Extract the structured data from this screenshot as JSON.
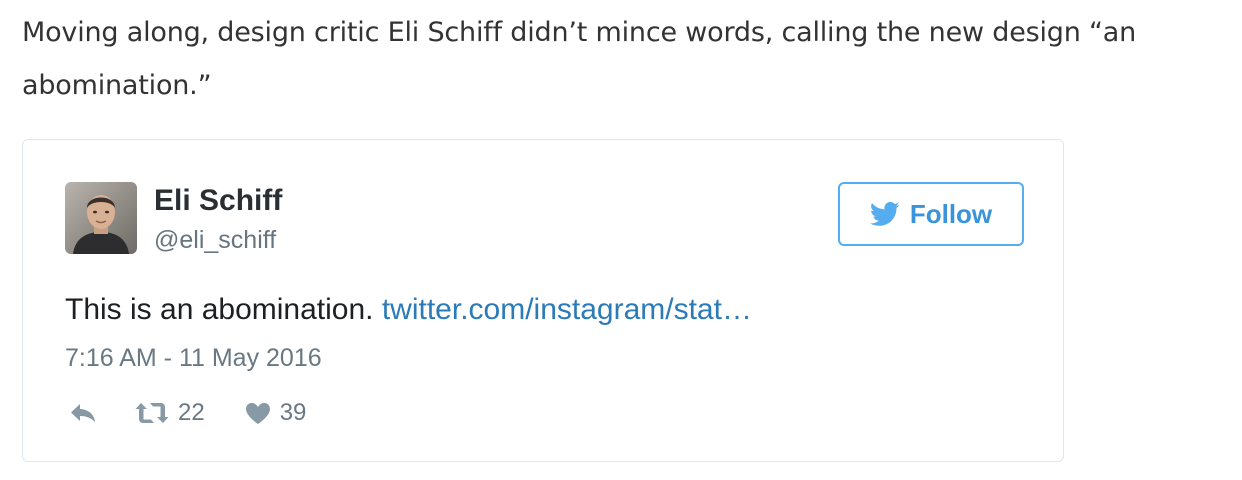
{
  "article": {
    "paragraph": "Moving along, design critic Eli Schiff didn’t mince words, calling the new design “an abomination.”"
  },
  "tweet": {
    "author_name": "Eli Schiff",
    "author_handle": "@eli_schiff",
    "follow_label": "Follow",
    "follow_icon": "twitter-bird-icon",
    "avatar_icon": "profile-photo",
    "text": "This is an abomination.",
    "link_text": "twitter.com/instagram/stat…",
    "timestamp": "7:16 AM - 11 May 2016",
    "retweet_count": "22",
    "like_count": "39",
    "action_icons": [
      "reply-icon",
      "retweet-icon",
      "heart-icon"
    ]
  },
  "colors": {
    "article_text": "#333333",
    "twitter_blue": "#55acee",
    "link": "#2b7bb9",
    "secondary_text": "#697882",
    "card_border": "#e1e8ed"
  }
}
